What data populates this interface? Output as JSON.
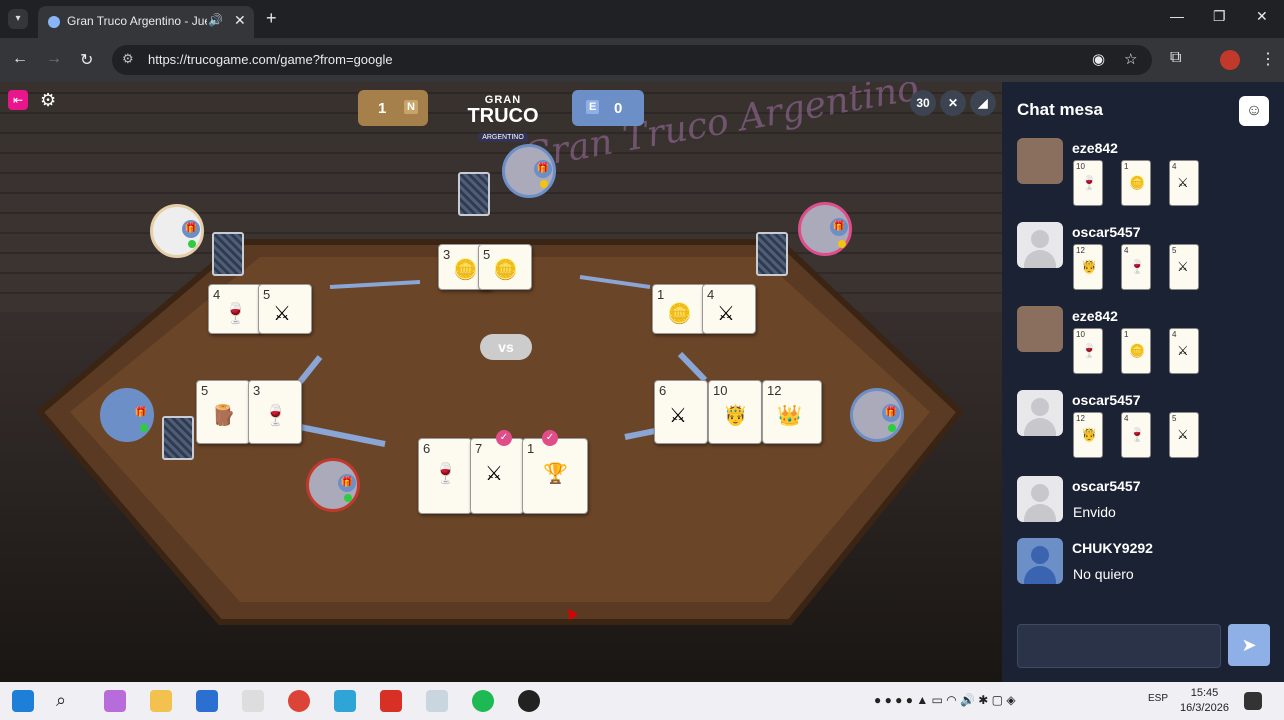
{
  "browser": {
    "tab_title": "Gran Truco Argentino - Jue",
    "url": "https://trucogame.com/game?from=google"
  },
  "game": {
    "score_n": {
      "points": "1",
      "team": "N"
    },
    "score_e": {
      "points": "0",
      "team": "E"
    },
    "logo": {
      "line1": "GRAN",
      "line2": "TRUCO",
      "line3": "ARGENTINO"
    },
    "neon_sign": "Gran Truco Argentino",
    "timer": "30",
    "vs_label": "vs",
    "played_cards": {
      "top": [
        "3",
        "5"
      ],
      "top_left": [
        "4",
        "5"
      ],
      "top_right": [
        "1",
        "4"
      ],
      "left": [
        "5",
        "3"
      ],
      "right": [
        "6",
        "10",
        "12"
      ],
      "bottom": [
        "6",
        "7",
        "1"
      ]
    }
  },
  "chat": {
    "title": "Chat mesa",
    "messages": [
      {
        "user": "eze842",
        "cards": [
          "10",
          "1",
          "4"
        ]
      },
      {
        "user": "oscar5457",
        "cards": [
          "12",
          "4",
          "5"
        ]
      },
      {
        "user": "eze842",
        "cards": [
          "10",
          "1",
          "4"
        ]
      },
      {
        "user": "oscar5457",
        "cards": [
          "12",
          "4",
          "5"
        ]
      },
      {
        "user": "oscar5457",
        "text": "Envido"
      },
      {
        "user": "CHUKY9292",
        "text": "No quiero"
      }
    ]
  },
  "taskbar": {
    "language": "ESP",
    "time": "15:45",
    "date": "16/3/2026"
  }
}
